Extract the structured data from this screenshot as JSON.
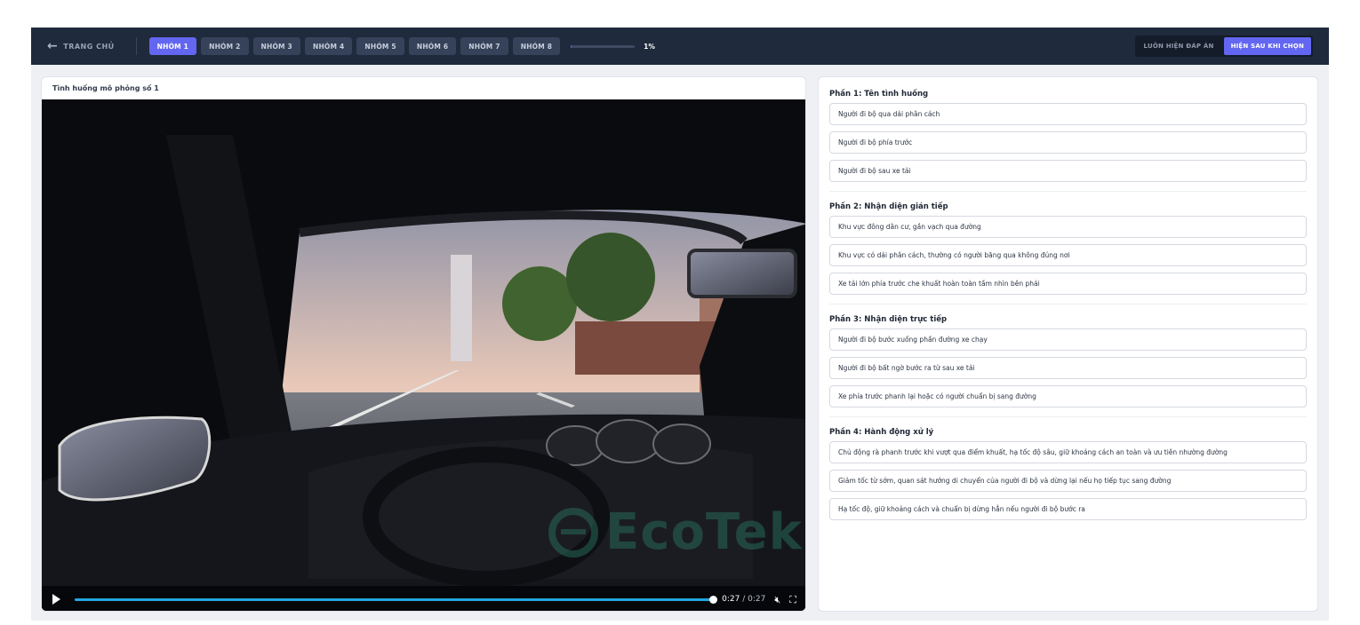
{
  "topbar": {
    "back_label": "TRANG CHỦ",
    "groups": [
      {
        "label": "NHÓM 1",
        "active": true
      },
      {
        "label": "NHÓM 2",
        "active": false
      },
      {
        "label": "NHÓM 3",
        "active": false
      },
      {
        "label": "NHÓM 4",
        "active": false
      },
      {
        "label": "NHÓM 5",
        "active": false
      },
      {
        "label": "NHÓM 6",
        "active": false
      },
      {
        "label": "NHÓM 7",
        "active": false
      },
      {
        "label": "NHÓM 8",
        "active": false
      }
    ],
    "progress_percent": 1,
    "progress_text": "1%",
    "mode_always": "LUÔN HIỆN ĐÁP ÁN",
    "mode_after": "HIỆN SAU KHI CHỌN",
    "accent": "#6366f1"
  },
  "video": {
    "title": "Tình huống mô phỏng số 1",
    "current_time": "0:27",
    "separator": "/",
    "duration": "0:27",
    "played_fraction": 1.0,
    "watermark": "EcoTek"
  },
  "sections": [
    {
      "title": "Phần 1: Tên tình huống",
      "options": [
        "Người đi bộ qua dải phân cách",
        "Người đi bộ phía trước",
        "Người đi bộ sau xe tải"
      ]
    },
    {
      "title": "Phần 2: Nhận diện gián tiếp",
      "options": [
        "Khu vực đông dân cư, gần vạch qua đường",
        "Khu vực có dải phân cách, thường có người băng qua không đúng nơi",
        "Xe tải lớn phía trước che khuất hoàn toàn tầm nhìn bên phải"
      ]
    },
    {
      "title": "Phần 3: Nhận diện trực tiếp",
      "options": [
        "Người đi bộ bước xuống phần đường xe chạy",
        "Người đi bộ bất ngờ bước ra từ sau xe tải",
        "Xe phía trước phanh lại hoặc có người chuẩn bị sang đường"
      ]
    },
    {
      "title": "Phần 4: Hành động xử lý",
      "options": [
        "Chủ động rà phanh trước khi vượt qua điểm khuất, hạ tốc độ sâu, giữ khoảng cách an toàn và ưu tiên nhường đường",
        "Giảm tốc từ sớm, quan sát hướng di chuyển của người đi bộ và dừng lại nếu họ tiếp tục sang đường",
        "Hạ tốc độ, giữ khoảng cách và chuẩn bị dừng hẳn nếu người đi bộ bước ra"
      ]
    }
  ]
}
